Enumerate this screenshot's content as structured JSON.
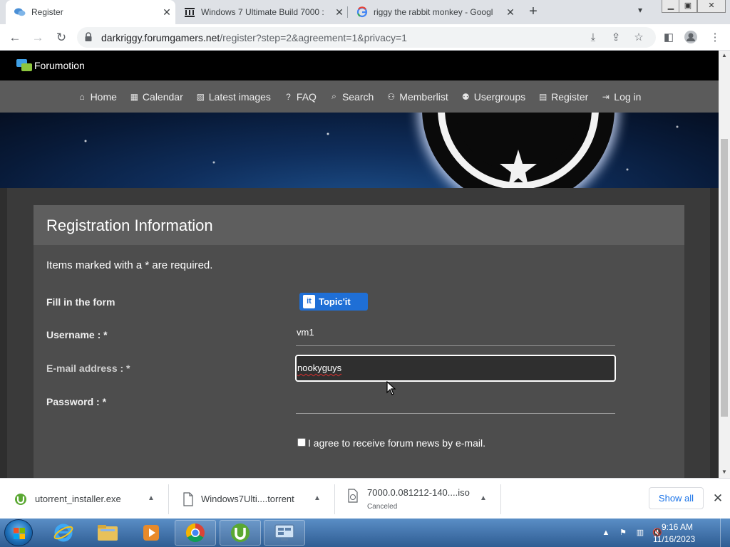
{
  "browser": {
    "tabs": [
      {
        "title": "Register",
        "icon": "chat-bubbles-icon",
        "active": true
      },
      {
        "title": "Windows 7 Ultimate Build 7000 :",
        "icon": "archive-building-icon",
        "active": false
      },
      {
        "title": "riggy the rabbit monkey - Googl",
        "icon": "google-g-icon",
        "active": false
      }
    ],
    "url_host": "darkriggy.forumgamers.net",
    "url_path": "/register?step=2&agreement=1&privacy=1"
  },
  "forum": {
    "brand": "Forumotion",
    "nav": [
      {
        "label": "Home",
        "icon": "home-icon"
      },
      {
        "label": "Calendar",
        "icon": "calendar-icon"
      },
      {
        "label": "Latest images",
        "icon": "image-icon"
      },
      {
        "label": "FAQ",
        "icon": "question-icon"
      },
      {
        "label": "Search",
        "icon": "search-icon"
      },
      {
        "label": "Memberlist",
        "icon": "members-icon"
      },
      {
        "label": "Usergroups",
        "icon": "usergroups-icon"
      },
      {
        "label": "Register",
        "icon": "register-icon"
      },
      {
        "label": "Log in",
        "icon": "login-icon"
      }
    ]
  },
  "form": {
    "title": "Registration Information",
    "required_note": "Items marked with a * are required.",
    "fill_label": "Fill in the form",
    "topicit_label": "Topic'it",
    "username_label": "Username : *",
    "username_value": "vm1",
    "email_label": "E-mail address : *",
    "email_value": "nookyguys",
    "password_label": "Password : *",
    "password_value": "",
    "newsletter_label": "I agree to receive forum news by e-mail."
  },
  "downloads": {
    "items": [
      {
        "name": "utorrent_installer.exe",
        "status": ""
      },
      {
        "name": "Windows7Ulti....torrent",
        "status": ""
      },
      {
        "name": "7000.0.081212-140....iso",
        "status": "Canceled"
      }
    ],
    "show_all": "Show all"
  },
  "taskbar": {
    "time": "9:16 AM",
    "date": "11/16/2023"
  },
  "colors": {
    "accent": "#1f6fd6",
    "navbar": "#5b5b5b",
    "panel": "#4d4d4d",
    "taskbar": "#2f5d93"
  }
}
